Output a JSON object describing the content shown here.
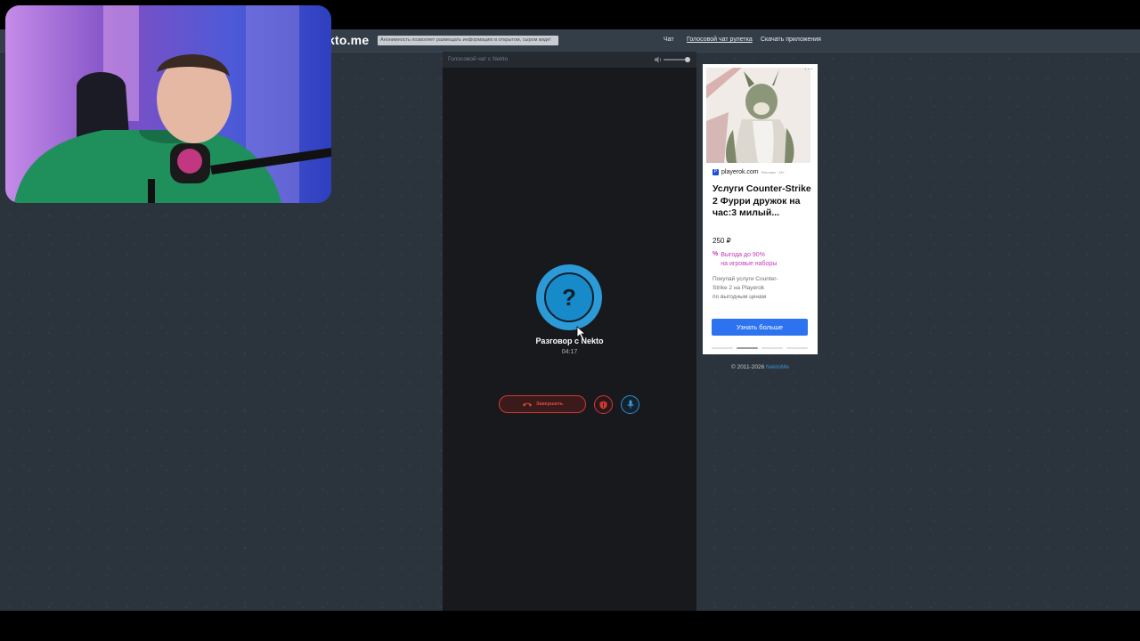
{
  "site": {
    "logo": "ekto.me",
    "notice": "Анонимность позволяет размещать информацию в открытом, сыром виде!"
  },
  "nav": {
    "items": [
      {
        "label": "Чат",
        "active": false
      },
      {
        "label": "Голосовой чат рулетка",
        "active": true
      },
      {
        "label": "Скачать приложения",
        "active": false
      }
    ]
  },
  "chat": {
    "title": "Голосовой чат с Nekto",
    "avatar_glyph": "?",
    "status_title": "Разговор с Nekto",
    "timer": "04:17",
    "hangup_label": "Завершить",
    "volume_level": 0.8
  },
  "ad": {
    "domain": "playerok.com",
    "domain_sub": "Реклама · 18+",
    "title": "Услуги Counter-Strike 2 Фурри дружок на час:3 милый...",
    "price": "250 ₽",
    "promo_icon": "%",
    "promo": "Выгода до 90%\nна игровые наборы",
    "description": "Покупай услуги Counter-\nStrike 2 на Playerok\nпо выгодным ценам",
    "button": "Узнать больше",
    "menu": "···"
  },
  "footer": {
    "copyright": "© 2011-2026",
    "link": "NektoMe"
  },
  "colors": {
    "background": "#2b333c",
    "header": "#343e49",
    "chat_panel": "#17191d",
    "accent_blue": "#2b9ad6",
    "danger_red": "#d13a32",
    "ad_button": "#2d73f0",
    "ad_promo": "#c23ab8"
  },
  "icons": {
    "volume": "volume-icon",
    "hangup": "phone-hangup-icon",
    "report": "shield-icon",
    "mic": "microphone-icon",
    "cursor": "mouse-cursor-icon"
  }
}
